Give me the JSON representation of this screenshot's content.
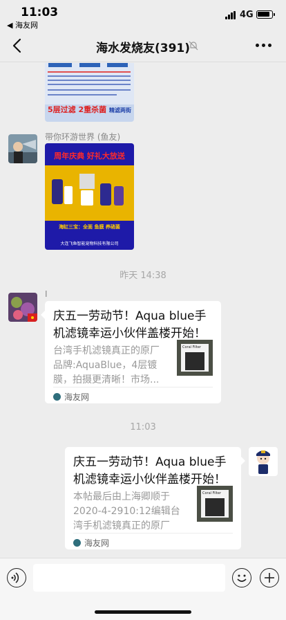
{
  "status_bar": {
    "time": "11:03",
    "back_app": "◀ 海友网",
    "network": "4G"
  },
  "nav": {
    "title": "海水发烧友(391)"
  },
  "messages": [
    {
      "type": "image",
      "sender": "",
      "poster_text": [
        "5层过滤",
        "2重杀菌",
        "精滤两街"
      ]
    },
    {
      "type": "image",
      "sender": "带你环游世界 (鱼友)",
      "poster_text": [
        "周年庆典 好礼大放送",
        "海缸三宝：全面 鱼膜 养硝菌",
        "大连飞鱼智能宠物科技有限公司"
      ]
    },
    {
      "type": "time",
      "text": "昨天 14:38"
    },
    {
      "type": "card",
      "sender": "I",
      "title": "庆五一劳动节！Aqua blue手机滤镜幸运小伙伴盖楼开始！",
      "desc": "台湾手机滤镜真正的原厂品牌:AquaBlue，4层镀膜，拍摄更清晰！市场...",
      "source": "海友网",
      "thumb_text": "Coral Filter"
    },
    {
      "type": "time",
      "text": "11:03"
    },
    {
      "type": "card",
      "sender": "",
      "title": "庆五一劳动节！Aqua blue手机滤镜幸运小伙伴盖楼开始！",
      "desc": "本帖最后由上海卿顺于2020-4-2910:12编辑台湾手机滤镜真正的原厂品...",
      "source": "海友网",
      "thumb_text": "Coral Filter"
    }
  ],
  "input": {
    "placeholder": ""
  }
}
